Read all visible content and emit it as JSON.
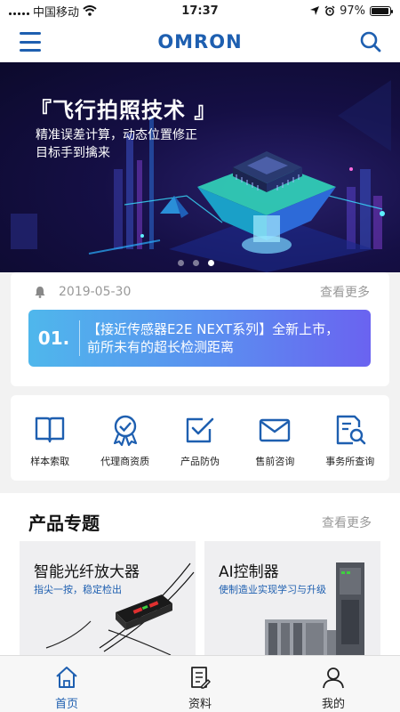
{
  "status_bar": {
    "carrier": "中国移动",
    "time": "17:37",
    "battery_text": "97%",
    "battery_level": 0.97
  },
  "header": {
    "logo": "OMRON",
    "menu_icon": "menu-icon",
    "search_icon": "search-icon"
  },
  "banner": {
    "title": "『飞行拍照技术 』",
    "subtitle_lines": [
      "精准误差计算，动态位置修正",
      "目标手到擒来"
    ],
    "slide_count": 3,
    "active_slide": 3
  },
  "news": {
    "date": "2019-05-30",
    "more": "查看更多",
    "number": "01.",
    "text_line1": "【接近传感器E2E NEXT系列】全新上市，",
    "text_line2": "前所未有的超长检测距离"
  },
  "quick_links": [
    {
      "label": "样本索取",
      "icon": "book-icon"
    },
    {
      "label": "代理商资质",
      "icon": "badge-icon"
    },
    {
      "label": "产品防伪",
      "icon": "checkbox-icon"
    },
    {
      "label": "售前咨询",
      "icon": "mail-icon"
    },
    {
      "label": "事务所查询",
      "icon": "document-search-icon"
    }
  ],
  "products": {
    "title": "产品专题",
    "more": "查看更多",
    "items": [
      {
        "title": "智能光纤放大器",
        "subtitle": "指尖一按，稳定检出"
      },
      {
        "title": "AI控制器",
        "subtitle": "使制造业实现学习与升级"
      }
    ]
  },
  "tabs": [
    {
      "label": "首页",
      "icon": "home-icon",
      "active": true
    },
    {
      "label": "资料",
      "icon": "document-icon",
      "active": false
    },
    {
      "label": "我的",
      "icon": "user-icon",
      "active": false
    }
  ],
  "colors": {
    "brand": "#1e5fb0",
    "news_gradient_start": "#4fb7ec",
    "news_gradient_end": "#6a63f0"
  }
}
